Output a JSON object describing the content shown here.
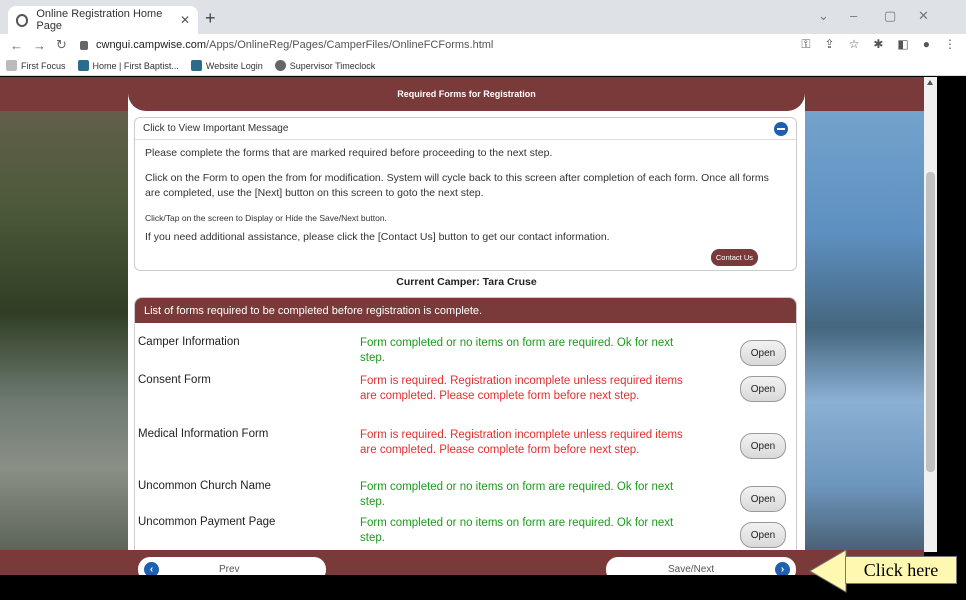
{
  "browser": {
    "tab_title": "Online Registration Home Page",
    "url_host": "cwngui.campwise.com",
    "url_path": "/Apps/OnlineReg/Pages/CamperFiles/OnlineFCForms.html",
    "bookmarks": [
      "First Focus",
      "Home | First Baptist...",
      "Website Login",
      "Supervisor Timeclock"
    ]
  },
  "page": {
    "title": "Required Forms for Registration",
    "message_header": "Click to View Important Message",
    "message_p1": "Please complete the forms that are marked required before proceeding to the next step.",
    "message_p2": "Click on the Form to open the from for modification. System will cycle back to this screen after completion of each form. Once all forms are completed, use the [Next] button on this screen to goto the next step.",
    "message_small": "Click/Tap on the screen to Display or Hide the Save/Next button.",
    "message_p3": "If you need additional assistance, please click the [Contact Us] button to get our contact information.",
    "contact_label": "Contact Us",
    "current_camper": "Current Camper: Tara Cruse",
    "list_header": "List of forms required to be completed before registration is complete.",
    "open_label": "Open",
    "forms": [
      {
        "name": "Camper Information",
        "status": "Form completed or no items on form are required. Ok for next step."
      },
      {
        "name": "Consent Form",
        "status": "Form is required. Registration incomplete unless required items are completed. Please complete form before next step."
      },
      {
        "name": "Medical Information Form",
        "status": "Form is required. Registration incomplete unless required items are completed. Please complete form before next step."
      },
      {
        "name": "Uncommon Church Name",
        "status": "Form completed or no items on form are required. Ok for next step."
      },
      {
        "name": "Uncommon Payment Page",
        "status": "Form completed or no items on form are required. Ok for next step."
      }
    ],
    "prev_label": "Prev",
    "next_label": "Save/Next"
  },
  "annotation": {
    "label": "Click here"
  },
  "colors": {
    "brand": "#7b3a3a",
    "ok": "#1c9a1c",
    "required": "#e23030",
    "accent": "#1d5fb1"
  }
}
